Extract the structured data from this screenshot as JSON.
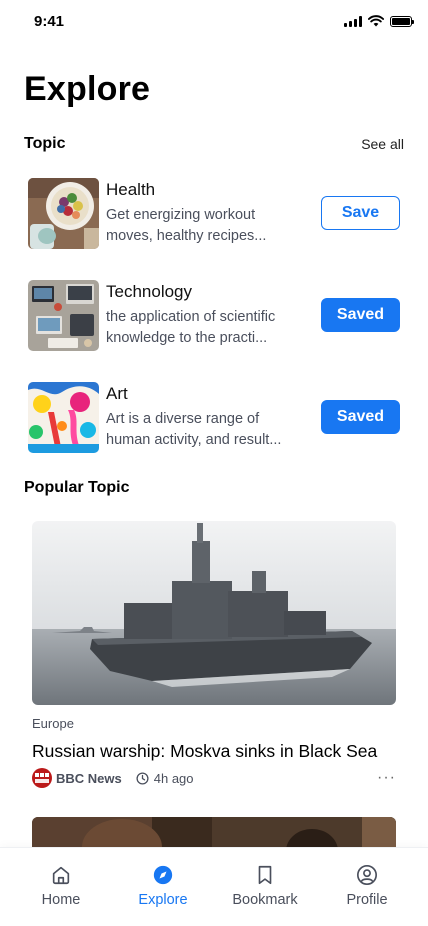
{
  "status_bar": {
    "time": "9:41"
  },
  "page": {
    "title": "Explore"
  },
  "topics_section": {
    "title": "Topic",
    "see_all": "See all",
    "items": [
      {
        "name": "Health",
        "desc_line1": "Get energizing workout",
        "desc_line2": "moves, healthy recipes...",
        "button": "Save",
        "saved": false
      },
      {
        "name": "Technology",
        "desc_line1": "the application of scientific",
        "desc_line2": "knowledge to the practi...",
        "button": "Saved",
        "saved": true
      },
      {
        "name": "Art",
        "desc_line1": "Art is a diverse range of",
        "desc_line2": "human activity, and result...",
        "button": "Saved",
        "saved": true
      }
    ]
  },
  "popular_section": {
    "title": "Popular Topic",
    "card": {
      "category": "Europe",
      "title": "Russian warship: Moskva sinks in Black Sea",
      "source": "BBC News",
      "source_logo_text": "BBC NEWS",
      "time": "4h ago",
      "more": "···"
    }
  },
  "bottom_nav": {
    "items": [
      {
        "label": "Home",
        "icon": "home-icon",
        "active": false
      },
      {
        "label": "Explore",
        "icon": "compass-icon",
        "active": true
      },
      {
        "label": "Bookmark",
        "icon": "bookmark-icon",
        "active": false
      },
      {
        "label": "Profile",
        "icon": "profile-icon",
        "active": false
      }
    ]
  },
  "colors": {
    "accent": "#1877f2",
    "text_secondary": "#4a4f5c",
    "source_red": "#bb1919"
  }
}
